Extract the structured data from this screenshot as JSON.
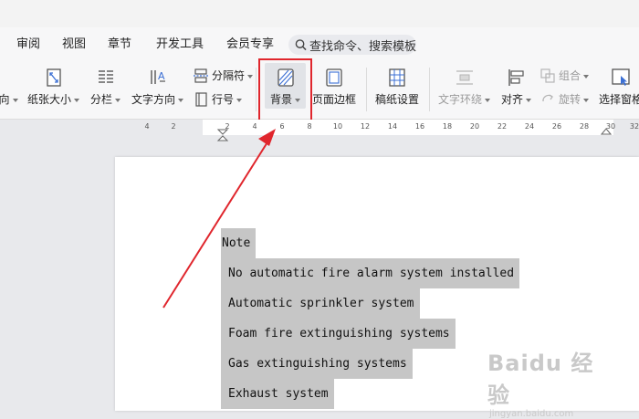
{
  "menu": {
    "tabs": [
      "审阅",
      "视图",
      "章节",
      "开发工具",
      "会员专享"
    ],
    "search_placeholder": "查找命令、搜索模板"
  },
  "ribbon": {
    "text_direction_cut": "向",
    "paper_size": "纸张大小",
    "columns": "分栏",
    "text_direction": "文字方向",
    "separator": "分隔符",
    "line_number": "行号",
    "background": "背景",
    "page_border": "页面边框",
    "manuscript_settings": "稿纸设置",
    "text_wrap": "文字环绕",
    "align": "对齐",
    "group": "组合",
    "rotate": "旋转",
    "select_pane": "选择窗格"
  },
  "ruler": {
    "ticks": [
      "4",
      "2",
      "2",
      "4",
      "6",
      "8",
      "10",
      "12",
      "14",
      "16",
      "18",
      "20",
      "22",
      "24",
      "26",
      "28",
      "30",
      "32"
    ]
  },
  "document": {
    "lines": [
      "Note",
      "No automatic fire alarm system installed",
      "Automatic sprinkler system",
      "Foam fire extinguishing systems",
      "Gas extinguishing systems",
      "Exhaust system"
    ]
  },
  "watermark": {
    "main": "Baidu 经验",
    "sub": "jingyan.baidu.com"
  },
  "colors": {
    "highlight": "#e0262d",
    "selection": "#c6c6c6",
    "accent": "#3b6fd4"
  }
}
